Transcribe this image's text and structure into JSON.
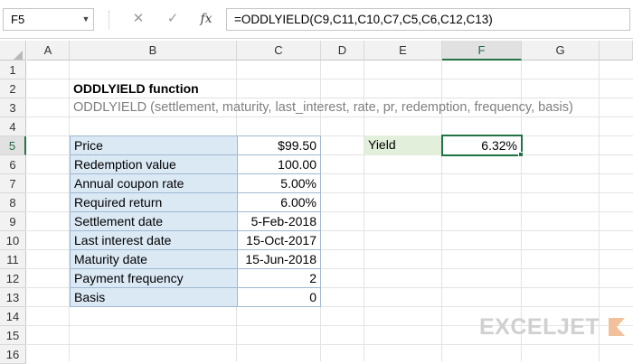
{
  "formula_bar": {
    "name_box": "F5",
    "cancel_glyph": "✕",
    "enter_glyph": "✓",
    "fx_label": "fx",
    "formula": "=ODDLYIELD(C9,C11,C10,C7,C5,C6,C12,C13)"
  },
  "grid": {
    "columns": [
      "A",
      "B",
      "C",
      "D",
      "E",
      "F",
      "G"
    ],
    "selected_column": "F",
    "rows": [
      "1",
      "2",
      "3",
      "4",
      "5",
      "6",
      "7",
      "8",
      "9",
      "10",
      "11",
      "12",
      "13",
      "14",
      "15",
      "16"
    ],
    "selected_row": "5"
  },
  "sheet": {
    "title": "ODDLYIELD function",
    "syntax": "ODDLYIELD (settlement, maturity, last_interest, rate, pr, redemption, frequency, basis)",
    "inputs": [
      {
        "label": "Price",
        "value": "$99.50"
      },
      {
        "label": "Redemption value",
        "value": "100.00"
      },
      {
        "label": "Annual coupon rate",
        "value": "5.00%"
      },
      {
        "label": "Required return",
        "value": "6.00%"
      },
      {
        "label": "Settlement date",
        "value": "5-Feb-2018"
      },
      {
        "label": "Last interest date",
        "value": "15-Oct-2017"
      },
      {
        "label": "Maturity date",
        "value": "15-Jun-2018"
      },
      {
        "label": "Payment frequency",
        "value": "2"
      },
      {
        "label": "Basis",
        "value": "0"
      }
    ],
    "result": {
      "label": "Yield",
      "value": "6.32%"
    }
  },
  "logo": {
    "text": "EXCELJET",
    "color": "#d0d0d0"
  },
  "colors": {
    "accent": "#217346",
    "label_fill": "#dbe9f5",
    "result_fill": "#e2efda"
  }
}
